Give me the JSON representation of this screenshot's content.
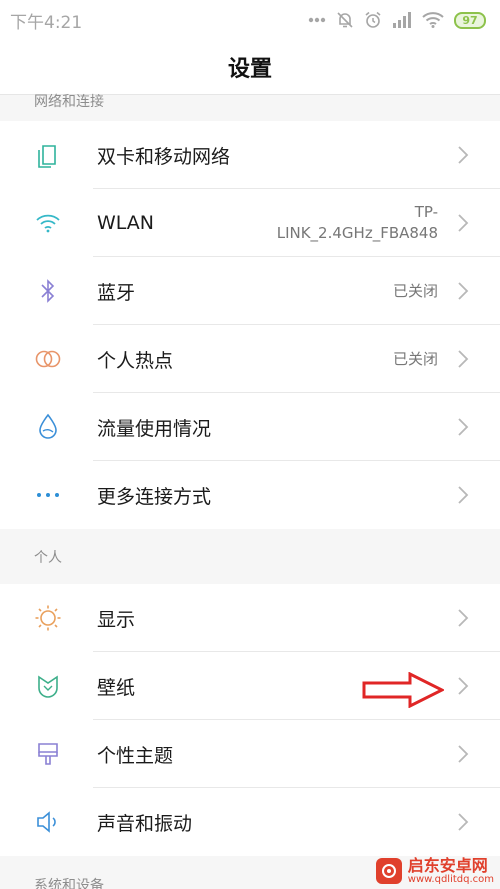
{
  "status_bar": {
    "time": "下午4:21",
    "battery": "97"
  },
  "header": {
    "title": "设置"
  },
  "sections": [
    {
      "title": "网络和连接",
      "items": [
        {
          "label": "双卡和移动网络",
          "value": "",
          "icon": "dual-sim-icon"
        },
        {
          "label": "WLAN",
          "value": "TP-LINK_2.4GHz_FBA848",
          "icon": "wifi-icon"
        },
        {
          "label": "蓝牙",
          "value": "已关闭",
          "icon": "bluetooth-icon"
        },
        {
          "label": "个人热点",
          "value": "已关闭",
          "icon": "hotspot-icon"
        },
        {
          "label": "流量使用情况",
          "value": "",
          "icon": "data-usage-icon"
        },
        {
          "label": "更多连接方式",
          "value": "",
          "icon": "more-dots-icon"
        }
      ]
    },
    {
      "title": "个人",
      "items": [
        {
          "label": "显示",
          "value": "",
          "icon": "brightness-icon"
        },
        {
          "label": "壁纸",
          "value": "",
          "icon": "wallpaper-icon"
        },
        {
          "label": "个性主题",
          "value": "",
          "icon": "theme-brush-icon"
        },
        {
          "label": "声音和振动",
          "value": "",
          "icon": "speaker-icon"
        }
      ]
    },
    {
      "title": "系统和设备"
    }
  ],
  "wlan_value_lines": [
    "TP-",
    "LINK_2.4GHz_FBA848"
  ],
  "watermark": {
    "name": "启东安卓网",
    "url": "www.qdlitdq.com"
  },
  "colors": {
    "accent_blue": "#2d8fd6",
    "wifi_cyan": "#35b8c8",
    "bluetooth_purple": "#8a80d4",
    "hotspot_orange": "#e8956a",
    "display_orange": "#e9a05c",
    "wallpaper_green": "#3daf8a",
    "theme_purple": "#8a80d4",
    "sound_blue": "#3b8fd8",
    "annotation_red": "#e02626"
  }
}
